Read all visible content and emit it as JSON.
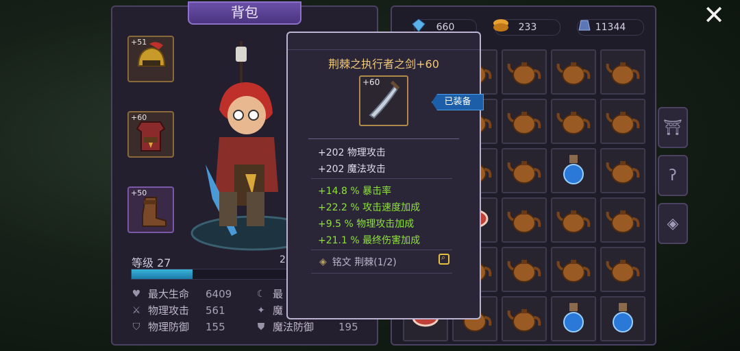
{
  "title": "背包",
  "close_icon": "close-icon",
  "currencies": [
    {
      "icon": "crystal-icon",
      "value": "660"
    },
    {
      "icon": "gold-coin-icon",
      "value": "233"
    },
    {
      "icon": "gem-icon",
      "value": "11344"
    }
  ],
  "equipment_slots": [
    {
      "level": "+51",
      "item": "helmet-icon"
    },
    {
      "level": "+60",
      "item": "armor-icon"
    },
    {
      "level": "+50",
      "item": "boots-icon"
    }
  ],
  "character": {
    "level_label": "等级",
    "level": "27",
    "xp_progress": 0.37,
    "stats_left": [
      {
        "icon": "heart-icon",
        "label": "最大生命",
        "value": "6409"
      },
      {
        "icon": "sword-icon",
        "label": "物理攻击",
        "value": "561"
      },
      {
        "icon": "shield-icon",
        "label": "物理防御",
        "value": "155"
      }
    ],
    "stats_right": [
      {
        "icon": "moon-icon",
        "label": "最",
        "value": ""
      },
      {
        "icon": "magic-icon",
        "label": "魔",
        "value": ""
      },
      {
        "icon": "magic-shield-icon",
        "label": "魔法防御",
        "value": "195"
      }
    ],
    "partial_value": "2"
  },
  "tooltip": {
    "name": "荆棘之执行者之剑+60",
    "item_level": "+60",
    "equipped_tag": "已装备",
    "base_stats": [
      "+202 物理攻击",
      "+202 魔法攻击"
    ],
    "bonus_stats": [
      "+14.8 % 暴击率",
      "+22.2 % 攻击速度加成",
      "+9.5 % 物理攻击加成",
      "+21.1 % 最终伤害加成"
    ],
    "rune": "铭文 荆棘(1/2)"
  },
  "inventory_tabs": [
    "equipment-tab-icon",
    "hook-tab-icon",
    "rune-tab-icon"
  ],
  "colors": {
    "accent": "#6a4fa8",
    "bonus_green": "#8fe23a",
    "title_gold": "#f0c878",
    "equipped_blue": "#1c5ea8"
  }
}
